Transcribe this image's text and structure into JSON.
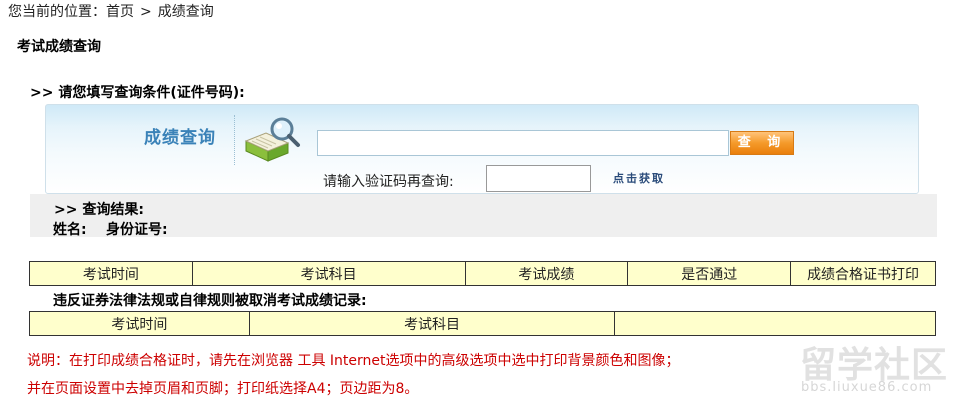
{
  "breadcrumb": {
    "prefix": "您当前的位置：",
    "home": "首页",
    "separator": ">",
    "current": "成绩查询"
  },
  "page_title": "考试成绩查询",
  "query": {
    "heading": ">> 请您填写查询条件(证件号码):",
    "title": "成绩查询",
    "search_value": "",
    "search_button": "查 询",
    "captcha_label": "请输入验证码再查询:",
    "captcha_value": "",
    "captcha_link": "点击获取"
  },
  "results": {
    "heading": ">> 查询结果:",
    "name_label": "姓名:",
    "id_label": "身份证号:"
  },
  "results_table": {
    "headers": [
      "考试时间",
      "考试科目",
      "考试成绩",
      "是否通过",
      "成绩合格证书打印"
    ]
  },
  "violations": {
    "heading": "违反证券法律法规或自律规则被取消考试成绩记录:",
    "headers": [
      "考试时间",
      "考试科目",
      ""
    ]
  },
  "notes": {
    "line1": "说明：在打印成绩合格证时，请先在浏览器 工具 Internet选项中的高级选项中选中打印背景颜色和图像；",
    "line2": "并在页面设置中去掉页眉和页脚；打印纸选择A4；页边距为8。"
  },
  "watermark": {
    "main": "留学社区",
    "url": "bbs.liuxue86.com"
  },
  "colors": {
    "table_bg": "#ffffcc",
    "title_blue": "#3a82b8",
    "note_red": "#cc0000",
    "button_orange": "#f59a2a"
  }
}
